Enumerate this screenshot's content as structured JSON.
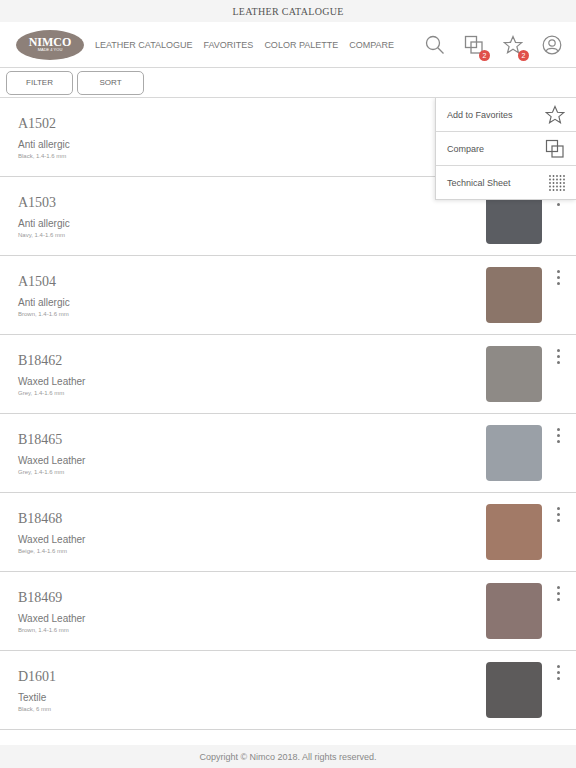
{
  "window": {
    "title": "LEATHER CATALOGUE"
  },
  "logo": {
    "name": "NIMCO",
    "tagline": "MADE 4 YOU"
  },
  "nav": {
    "items": [
      {
        "label": "LEATHER CATALOGUE"
      },
      {
        "label": "FAVORITES"
      },
      {
        "label": "COLOR PALETTE"
      },
      {
        "label": "COMPARE"
      }
    ]
  },
  "header_badges": {
    "compare": "2",
    "favorites": "2"
  },
  "toolbar": {
    "buttons": [
      "FILTER",
      "SORT"
    ]
  },
  "rows": [
    {
      "code": "A1502",
      "type": "Anti allergic",
      "detail": "Black, 1.4-1.6 mm",
      "color": "#3a3a3c"
    },
    {
      "code": "A1503",
      "type": "Anti allergic",
      "detail": "Navy, 1.4-1.6 mm",
      "color": "#5b5d62"
    },
    {
      "code": "A1504",
      "type": "Anti allergic",
      "detail": "Brown, 1.4-1.6 mm",
      "color": "#8b7569"
    },
    {
      "code": "B18462",
      "type": "Waxed Leather",
      "detail": "Grey, 1.4-1.6 mm",
      "color": "#8e8a86"
    },
    {
      "code": "B18465",
      "type": "Waxed Leather",
      "detail": "Grey, 1.4-1.6 mm",
      "color": "#9aa0a7"
    },
    {
      "code": "B18468",
      "type": "Waxed Leather",
      "detail": "Beige, 1.4-1.6 mm",
      "color": "#a27a67"
    },
    {
      "code": "B18469",
      "type": "Waxed Leather",
      "detail": "Brown, 1.4-1.6 mm",
      "color": "#8a7571"
    },
    {
      "code": "D1601",
      "type": "Textile",
      "detail": "Black, 6 mm",
      "color": "#5d5b5b"
    }
  ],
  "menu": {
    "items": [
      "Add to Favorites",
      "Compare",
      "Technical Sheet"
    ]
  },
  "footer": {
    "text": "Copyright © Nimco 2018. All rights reserved."
  }
}
